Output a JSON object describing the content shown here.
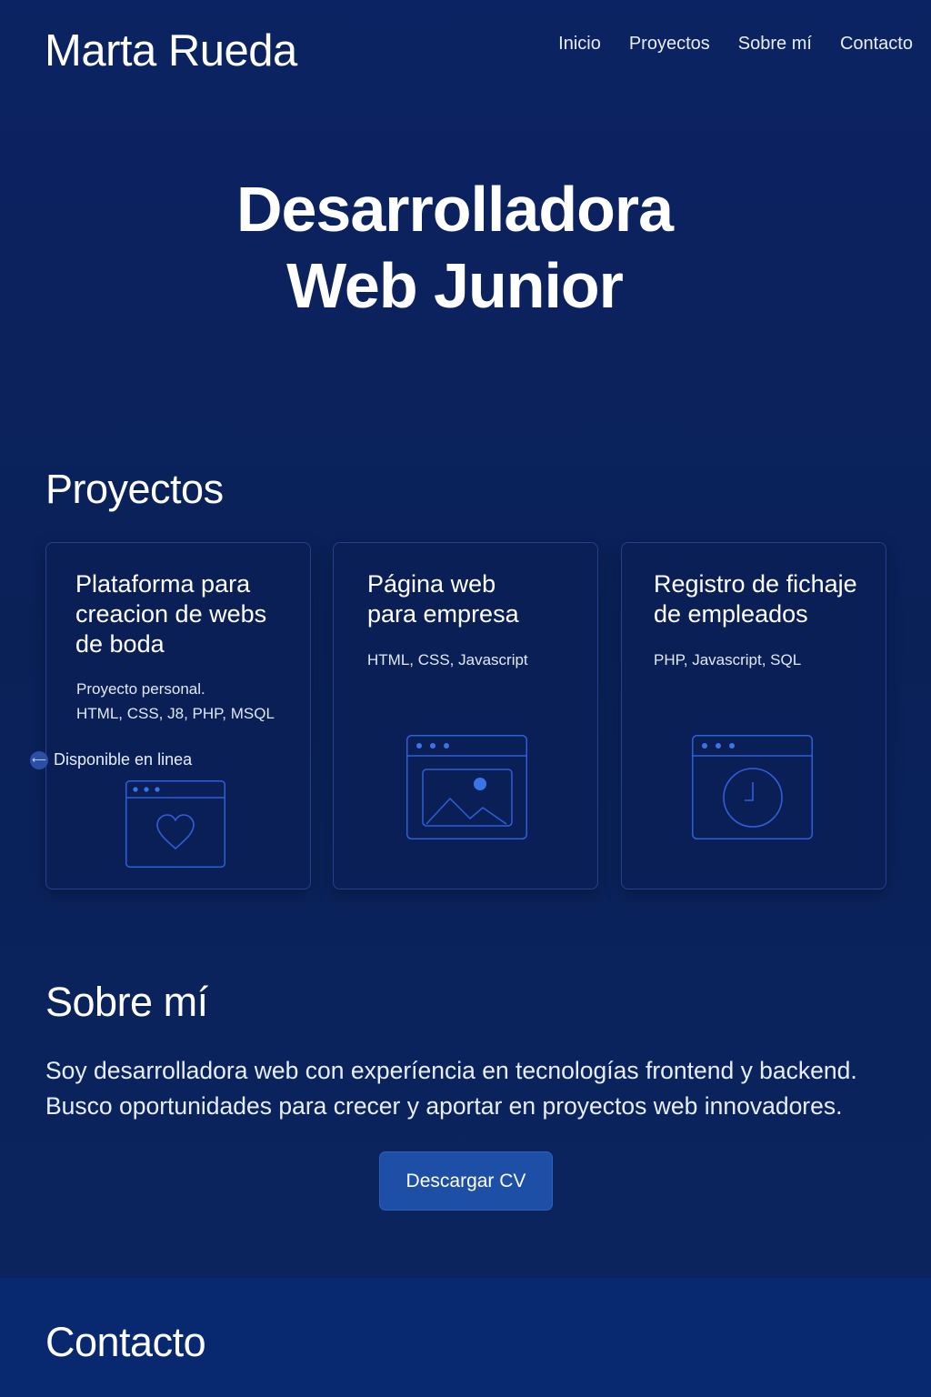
{
  "header": {
    "logo": "Marta Rueda",
    "nav": [
      "Inicio",
      "Proyectos",
      "Sobre mí",
      "Contacto"
    ]
  },
  "hero": {
    "line1": "Desarrolladora",
    "line2": "Web Junior"
  },
  "projects": {
    "title": "Proyectos",
    "cards": [
      {
        "title_lines": [
          "Plataforma para",
          "creacion de webs",
          "de boda"
        ],
        "description_lines": [
          "Proyecto personal.",
          "HTML, CSS, J8, PHP, MSQL"
        ],
        "status": "Disponible en linea",
        "icon": "browser-heart-icon"
      },
      {
        "title_lines": [
          "Página web",
          "para empresa"
        ],
        "description_lines": [
          "HTML, CSS, Javascript"
        ],
        "icon": "browser-image-icon"
      },
      {
        "title_lines": [
          "Registro de fichaje",
          "de empleados"
        ],
        "description_lines": [
          "PHP, Javascript, SQL"
        ],
        "icon": "browser-clock-icon"
      }
    ]
  },
  "about": {
    "title": "Sobre mí",
    "text_line1": "Soy desarrolladora web con experíencia en tecnologías frontend y backend.",
    "text_line2": "Busco oportunidades para crecer y aportar en proyectos web innovadores.",
    "button": "Descargar CV"
  },
  "contact": {
    "title": "Contacto"
  },
  "colors": {
    "background": "#0b2262",
    "card": "#0a1f55",
    "accent": "#1d4fa6",
    "icon_line": "#2f5fd8"
  }
}
